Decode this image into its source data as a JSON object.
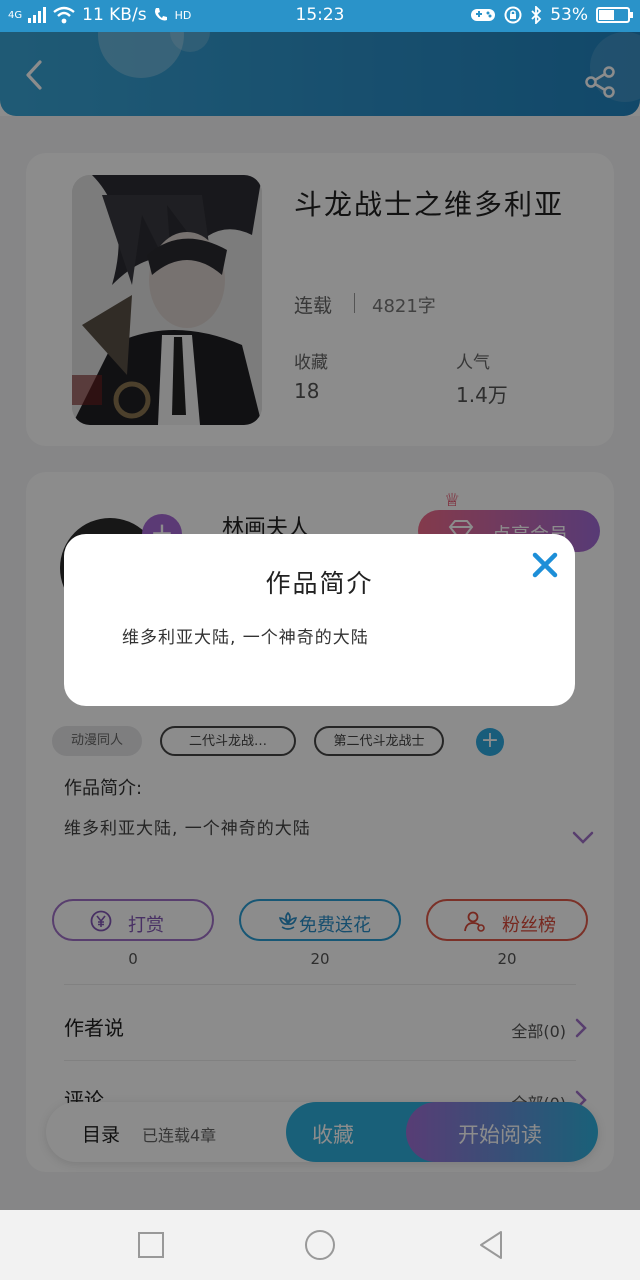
{
  "status_bar": {
    "network": "4G",
    "speed": "11 KB/s",
    "hd": "HD",
    "time": "15:23",
    "battery_percent": 53,
    "battery_label": "53%"
  },
  "header": {
    "back_icon": "chevron-left-icon",
    "share_icon": "share-icon"
  },
  "book": {
    "title": "斗龙战士之维多利亚",
    "status": "连载",
    "word_count": "4821字",
    "favorites_label": "收藏",
    "favorites_value": "18",
    "popularity_label": "人气",
    "popularity_value": "1.4万"
  },
  "author": {
    "name": "林画夫人",
    "vip_button": "点亮会员"
  },
  "tags": [
    {
      "label": "动漫同人"
    },
    {
      "label": "二代斗龙战…"
    },
    {
      "label": "第二代斗龙战士"
    }
  ],
  "intro": {
    "label": "作品简介:",
    "text": "维多利亚大陆, 一个神奇的大陆"
  },
  "actions": [
    {
      "label": "打赏",
      "count": "0",
      "icon": "yen-coin-icon"
    },
    {
      "label": "免费送花",
      "count": "20",
      "icon": "flower-icon"
    },
    {
      "label": "粉丝榜",
      "count": "20",
      "icon": "user-rank-icon"
    }
  ],
  "rows": {
    "author_says": {
      "title": "作者说",
      "right": "全部(0)"
    },
    "comments": {
      "title": "评论",
      "right": "全部(0)"
    }
  },
  "bottom_bar": {
    "toc": "目录",
    "chapters": "已连载4章",
    "collect": "收藏",
    "read": "开始阅读"
  },
  "modal": {
    "title": "作品简介",
    "body": "维多利亚大陆, 一个神奇的大陆",
    "close_icon": "close-icon"
  },
  "colors": {
    "header_blue": "#2b8fc8",
    "accent_blue": "#2fb0dc",
    "accent_purple": "#a071c9",
    "accent_red": "#e05a4a"
  }
}
